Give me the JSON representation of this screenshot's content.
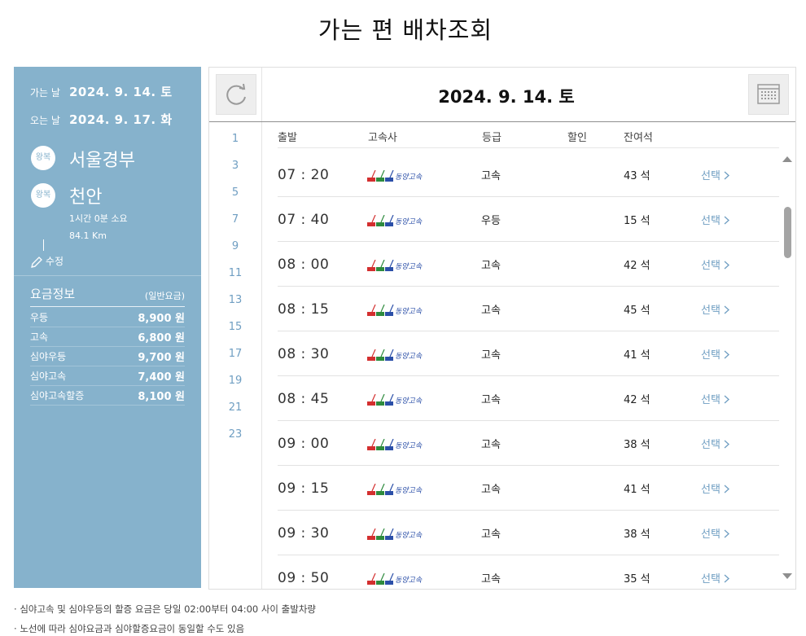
{
  "page_title": "가는 편 배차조회",
  "info": {
    "depart_label": "가는 날",
    "depart_date": "2024. 9. 14. 토",
    "return_label": "오는 날",
    "return_date": "2024. 9. 17. 화",
    "route_badge": "왕복",
    "origin": "서울경부",
    "destination": "천안",
    "duration": "1시간 0분 소요",
    "distance": "84.1 Km",
    "edit_label": "수정"
  },
  "fares": {
    "title": "요금정보",
    "note": "(일반요금)",
    "items": [
      {
        "grade": "우등",
        "price": "8,900 원"
      },
      {
        "grade": "고속",
        "price": "6,800 원"
      },
      {
        "grade": "심야우등",
        "price": "9,700 원"
      },
      {
        "grade": "심야고속",
        "price": "7,400 원"
      },
      {
        "grade": "심야고속할증",
        "price": "8,100 원"
      }
    ]
  },
  "schedule": {
    "date": "2024. 9. 14. 토",
    "hours": [
      "1",
      "3",
      "5",
      "7",
      "9",
      "11",
      "13",
      "15",
      "17",
      "19",
      "21",
      "23"
    ],
    "columns": {
      "depart": "출발",
      "company": "고속사",
      "grade": "등급",
      "discount": "할인",
      "seats": "잔여석"
    },
    "company_name": "동양고속",
    "select_label": "선택",
    "rows": [
      {
        "time": "07 : 20",
        "grade": "고속",
        "seats": "43 석"
      },
      {
        "time": "07 : 40",
        "grade": "우등",
        "seats": "15 석"
      },
      {
        "time": "08 : 00",
        "grade": "고속",
        "seats": "42 석"
      },
      {
        "time": "08 : 15",
        "grade": "고속",
        "seats": "45 석"
      },
      {
        "time": "08 : 30",
        "grade": "고속",
        "seats": "41 석"
      },
      {
        "time": "08 : 45",
        "grade": "고속",
        "seats": "42 석"
      },
      {
        "time": "09 : 00",
        "grade": "고속",
        "seats": "38 석"
      },
      {
        "time": "09 : 15",
        "grade": "고속",
        "seats": "41 석"
      },
      {
        "time": "09 : 30",
        "grade": "고속",
        "seats": "38 석"
      },
      {
        "time": "09 : 50",
        "grade": "고속",
        "seats": "35 석"
      }
    ]
  },
  "notes": [
    "심야고속 및 심야우등의 할증 요금은 당일 02:00부터 04:00 사이 출발차량",
    "노선에 따라 심야요금과 심야할증요금이 동일할 수도 있음"
  ],
  "icons": {
    "refresh": "refresh-icon",
    "calendar": "calendar-icon",
    "edit": "pencil-icon",
    "scroll_up": "scroll-up-icon",
    "scroll_down": "scroll-down-icon",
    "chevron": "chevron-right-icon"
  },
  "colors": {
    "panel": "#86b2cc",
    "link": "#6f9ec2",
    "logo_red": "#d32f2f",
    "logo_green": "#2e8b3e",
    "logo_blue": "#2b4fa8"
  }
}
